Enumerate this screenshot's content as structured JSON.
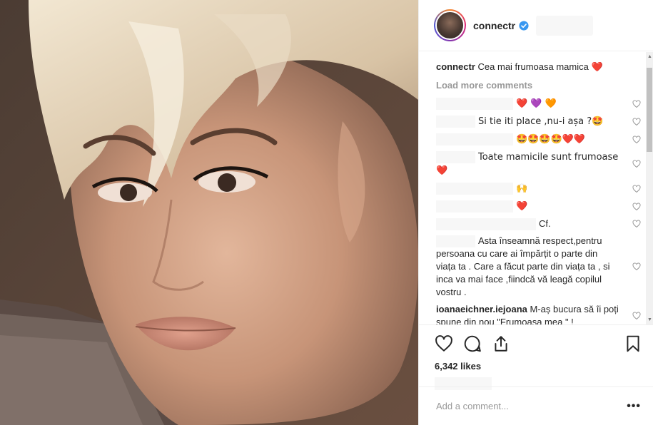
{
  "post": {
    "username": "connectr",
    "verified": true,
    "caption_user": "connectr",
    "caption_text": "Cea mai frumoasa mamica",
    "caption_emoji": "❤️"
  },
  "comments_ui": {
    "load_more": "Load more comments"
  },
  "comments": [
    {
      "text": "❤️ 💜 🧡"
    },
    {
      "text": "Si tie iti place ,nu-i așa ?🤩"
    },
    {
      "text": "🤩🤩🤩🤩❤️❤️"
    },
    {
      "text": "Toate mamicile sunt frumoase❤️"
    },
    {
      "text": "🙌"
    },
    {
      "text": "❤️"
    },
    {
      "text": "Cf."
    },
    {
      "text": "Asta înseamnă respect,pentru persoana cu care ai împărțit o parte din viața ta . Care a făcut parte din viața ta , si inca va mai face ,fiindcă vă leagă copilul vostru ."
    },
    {
      "user": "ioanaeichner.iejoana",
      "text": "M-aș bucura să îi poți spune din nou \"Frumoasa mea \" !"
    }
  ],
  "likes": "6,342 likes",
  "add_comment": {
    "placeholder": "Add a comment..."
  },
  "icons": {
    "like": "heart-outline-icon",
    "comment": "speech-bubble-icon",
    "share": "share-upload-icon",
    "save": "bookmark-icon",
    "options": "more-options-icon",
    "verified": "verified-badge-icon"
  },
  "colors": {
    "verified": "#3897f0",
    "muted": "#999999",
    "border": "#efefef"
  }
}
